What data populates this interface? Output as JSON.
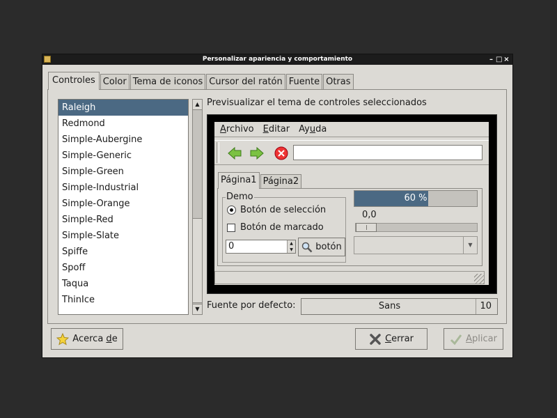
{
  "window": {
    "title": "Personalizar apariencia y comportamiento",
    "controls": [
      "–",
      "□",
      "×"
    ]
  },
  "tabs": [
    "Controles",
    "Color",
    "Tema de iconos",
    "Cursor del ratón",
    "Fuente",
    "Otras"
  ],
  "active_tab": "Controles",
  "theme_list": {
    "items": [
      "Raleigh",
      "Redmond",
      "Simple-Aubergine",
      "Simple-Generic",
      "Simple-Green",
      "Simple-Industrial",
      "Simple-Orange",
      "Simple-Red",
      "Simple-Slate",
      "Spiffe",
      "Spoff",
      "Taqua",
      "ThinIce"
    ],
    "selected": "Raleigh"
  },
  "preview": {
    "label": "Previsualizar el tema de controles seleccionados",
    "menu": [
      {
        "pre": "",
        "u": "A",
        "post": "rchivo"
      },
      {
        "pre": "",
        "u": "E",
        "post": "ditar"
      },
      {
        "pre": "Ay",
        "u": "u",
        "post": "da"
      }
    ],
    "toolbar_icons": [
      "back-arrow-icon",
      "forward-arrow-icon",
      "stop-icon"
    ],
    "entry_value": "",
    "tabs": [
      "Página1",
      "Página2"
    ],
    "demo_frame_label": "Demo",
    "radio_label": "Botón de selección",
    "checkbox_label": "Botón de marcado",
    "spin_value": "0",
    "button_label": "botón",
    "progress_text": "60 %",
    "progress_fraction": 0.6,
    "scale_value": "0,0",
    "scale_fraction": 0.0
  },
  "font": {
    "label": "Fuente por defecto:",
    "name": "Sans",
    "size": "10"
  },
  "buttons": {
    "about": {
      "pre": "Acerca ",
      "u": "d",
      "post": "e"
    },
    "close": {
      "pre": "",
      "u": "C",
      "post": "errar"
    },
    "apply": {
      "pre": "",
      "u": "A",
      "post": "plicar"
    }
  },
  "colors": {
    "selection": "#4b6983",
    "window_bg": "#dcdad5",
    "desktop_bg": "#2b2b2b"
  }
}
